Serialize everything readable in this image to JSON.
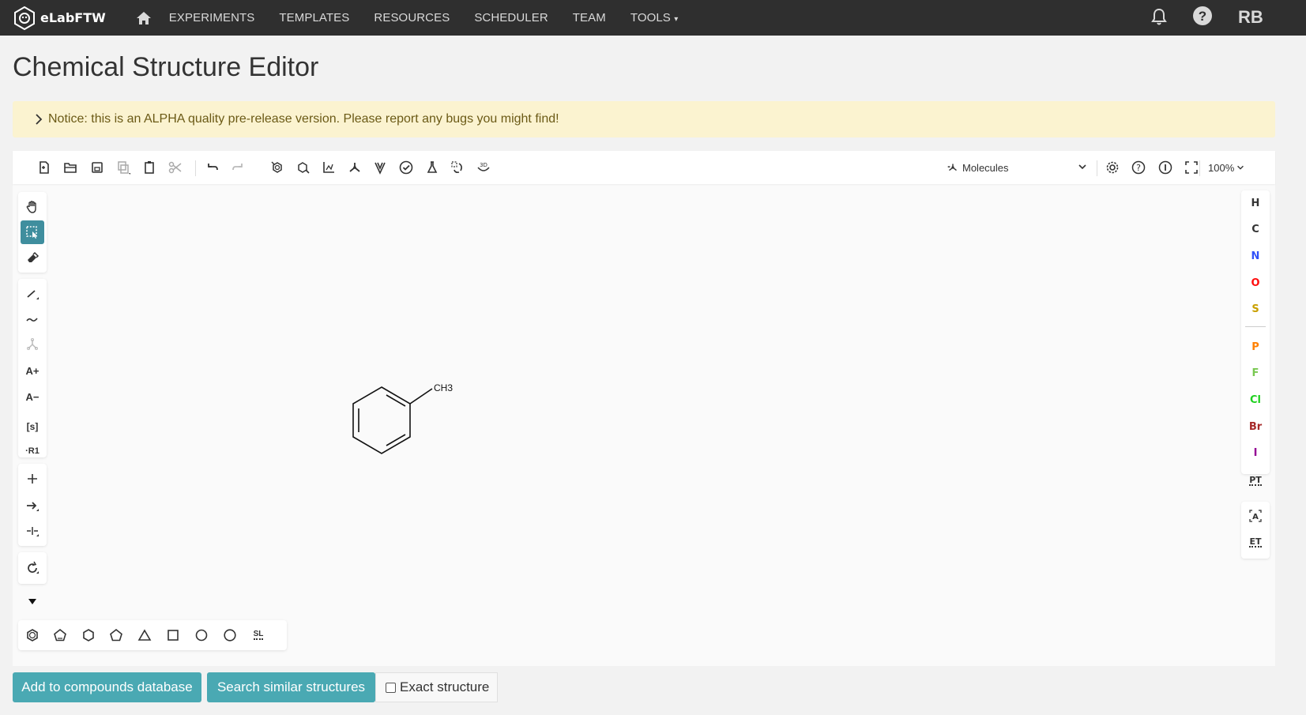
{
  "navbar": {
    "brand": "eLabFTW",
    "items": [
      {
        "label": "EXPERIMENTS"
      },
      {
        "label": "TEMPLATES"
      },
      {
        "label": "RESOURCES"
      },
      {
        "label": "SCHEDULER"
      },
      {
        "label": "TEAM"
      },
      {
        "label": "TOOLS"
      }
    ],
    "user_initials": "RB"
  },
  "page": {
    "title": "Chemical Structure Editor"
  },
  "notice": {
    "text": "Notice: this is an ALPHA quality pre-release version. Please report any bugs you might find!"
  },
  "editor": {
    "top_toolbar_icons": [
      "new-file-icon",
      "open-icon",
      "save-icon",
      "copy-icon",
      "paste-icon",
      "cut-icon",
      "undo-icon",
      "redo-icon",
      "aromatize-icon",
      "dearomatize-icon",
      "layout-icon",
      "clean-icon",
      "calculate-icon",
      "check-icon",
      "analyse-icon",
      "stereo-icon",
      "3d-view-icon"
    ],
    "mode_select": "Molecules",
    "zoom": "100%",
    "structure_label": "CH3",
    "atoms": [
      {
        "symbol": "H",
        "color": "#000000"
      },
      {
        "symbol": "C",
        "color": "#000000"
      },
      {
        "symbol": "N",
        "color": "#3050f8"
      },
      {
        "symbol": "O",
        "color": "#ff0d0d"
      },
      {
        "symbol": "S",
        "color": "#c9a000"
      },
      {
        "symbol": "P",
        "color": "#ff8000"
      },
      {
        "symbol": "F",
        "color": "#78c850"
      },
      {
        "symbol": "Cl",
        "color": "#1fd01f"
      },
      {
        "symbol": "Br",
        "color": "#a62929"
      },
      {
        "symbol": "I",
        "color": "#940094"
      }
    ],
    "left_labels": {
      "sgroup": "[s]",
      "rgroup": "·R1",
      "aplus": "A+",
      "aminus": "A−"
    },
    "periodic_table": "PT",
    "extended_table": "ET",
    "bottom_sl": "SL"
  },
  "actions": {
    "add_compounds": "Add to compounds database",
    "search_similar": "Search similar structures",
    "exact_structure": "Exact structure"
  }
}
